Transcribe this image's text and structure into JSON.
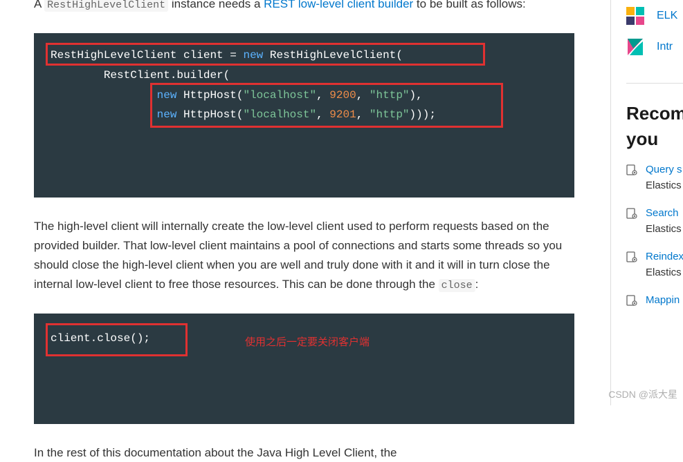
{
  "intro": {
    "prefix": "A ",
    "code": "RestHighLevelClient",
    "mid": " instance needs a ",
    "link": "REST low-level client builder",
    "suffix": " to be built as follows:"
  },
  "code1": {
    "line1_type1": "RestHighLevelClient",
    "line1_var": " client ",
    "line1_op": "=",
    "line1_kw": " new ",
    "line1_type2": "RestHighLevelClient",
    "line1_punc": "(",
    "line2_prefix": "        RestClient",
    "line2_method": ".builder",
    "line2_punc": "(",
    "line3_prefix": "                ",
    "line3_kw": "new",
    "line3_type": " HttpHost",
    "line3_p1": "(",
    "line3_str1": "\"localhost\"",
    "line3_c1": ", ",
    "line3_num": "9200",
    "line3_c2": ", ",
    "line3_str2": "\"http\"",
    "line3_p2": "),",
    "line4_prefix": "                ",
    "line4_kw": "new",
    "line4_type": " HttpHost",
    "line4_p1": "(",
    "line4_str1": "\"localhost\"",
    "line4_c1": ", ",
    "line4_num": "9201",
    "line4_c2": ", ",
    "line4_str2": "\"http\"",
    "line4_p2": ")));"
  },
  "paragraph": {
    "text_before": "The high-level client will internally create the low-level client used to perform requests based on the provided builder. That low-level client maintains a pool of connections and starts some threads so you should close the high-level client when you are well and truly done with it and it will in turn close the internal low-level client to free those resources. This can be done through the ",
    "code": "close",
    "text_after": ":"
  },
  "code2": {
    "line": "client.close();",
    "annotation": "使用之后一定要关闭客户端"
  },
  "bottom_cutoff": "In the rest of this documentation about the Java High Level Client, the",
  "sidebar": {
    "link_elk": "ELK",
    "link_kibana": "Intr",
    "heading1": "Recomm",
    "heading2": "you",
    "items": [
      {
        "link": "Query s",
        "sub": "Elastics"
      },
      {
        "link": "Search",
        "sub": "Elastics"
      },
      {
        "link": "Reindex",
        "sub": "Elastics"
      },
      {
        "link": "Mappin",
        "sub": ""
      }
    ]
  },
  "watermark": "CSDN @派大星"
}
